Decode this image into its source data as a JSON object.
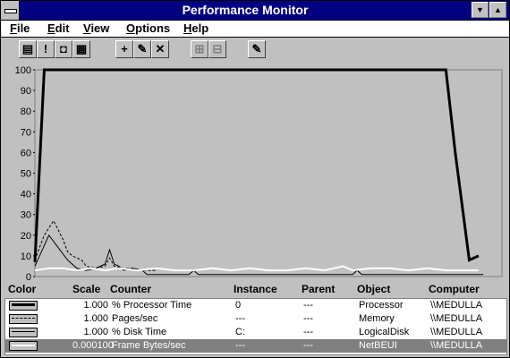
{
  "window": {
    "title": "Performance Monitor"
  },
  "titlebar": {
    "minimize_glyph": "▼",
    "maximize_glyph": "▲"
  },
  "menu": [
    {
      "label": "File",
      "mnemonic": "F"
    },
    {
      "label": "Edit",
      "mnemonic": "E"
    },
    {
      "label": "View",
      "mnemonic": "V"
    },
    {
      "label": "Options",
      "mnemonic": "O"
    },
    {
      "label": "Help",
      "mnemonic": "H"
    }
  ],
  "toolbar": [
    {
      "name": "chart-view-icon",
      "glyph": "▤",
      "enabled": true
    },
    {
      "name": "alert-view-icon",
      "glyph": "!",
      "enabled": true
    },
    {
      "name": "log-view-icon",
      "glyph": "◘",
      "enabled": true
    },
    {
      "name": "report-view-icon",
      "glyph": "▦",
      "enabled": true
    },
    {
      "name": "add-counter-icon",
      "glyph": "+",
      "enabled": true
    },
    {
      "name": "edit-counter-icon",
      "glyph": "✎",
      "enabled": true
    },
    {
      "name": "delete-counter-icon",
      "glyph": "✕",
      "enabled": true
    },
    {
      "name": "update-data-icon",
      "glyph": "⊞",
      "enabled": false
    },
    {
      "name": "bookmark-icon",
      "glyph": "⊟",
      "enabled": false
    },
    {
      "name": "options-icon",
      "glyph": "✎",
      "enabled": true
    }
  ],
  "chart_data": {
    "type": "line",
    "ylim": [
      0,
      100
    ],
    "yticks": [
      "100",
      "90",
      "80",
      "70",
      "60",
      "50",
      "40",
      "30",
      "20",
      "10",
      "0"
    ],
    "xlim": [
      0,
      100
    ],
    "series": [
      {
        "style": "solid",
        "color": "#000000",
        "points": [
          [
            0,
            7
          ],
          [
            2,
            100
          ],
          [
            10,
            100
          ],
          [
            20,
            100
          ],
          [
            30,
            100
          ],
          [
            40,
            100
          ],
          [
            50,
            100
          ],
          [
            60,
            100
          ],
          [
            70,
            100
          ],
          [
            80,
            100
          ],
          [
            88,
            100
          ],
          [
            90,
            60
          ],
          [
            93,
            8
          ],
          [
            95,
            10
          ]
        ]
      },
      {
        "style": "dashed",
        "color": "#000000",
        "points": [
          [
            0,
            8
          ],
          [
            2,
            20
          ],
          [
            4,
            27
          ],
          [
            6,
            18
          ],
          [
            7,
            12
          ],
          [
            8,
            10
          ],
          [
            9,
            9
          ],
          [
            10,
            8
          ],
          [
            11,
            5
          ],
          [
            13,
            4
          ],
          [
            15,
            5
          ],
          [
            16,
            9
          ],
          [
            17,
            5
          ],
          [
            19,
            4
          ],
          [
            21,
            4
          ],
          [
            22,
            3
          ],
          [
            24,
            3
          ],
          [
            26,
            3
          ]
        ]
      },
      {
        "style": "solid",
        "color": "#000000",
        "points": [
          [
            0,
            5
          ],
          [
            3,
            20
          ],
          [
            5,
            14
          ],
          [
            7,
            8
          ],
          [
            9,
            4
          ],
          [
            11,
            3
          ],
          [
            13,
            4
          ],
          [
            15,
            6
          ],
          [
            16,
            13
          ],
          [
            17,
            6
          ],
          [
            18,
            5
          ],
          [
            19,
            3
          ],
          [
            21,
            4
          ],
          [
            23,
            3
          ],
          [
            24,
            1
          ],
          [
            33,
            1
          ],
          [
            34,
            3
          ],
          [
            35,
            1
          ],
          [
            68,
            1
          ],
          [
            69,
            3
          ],
          [
            70,
            1
          ],
          [
            96,
            1
          ]
        ]
      },
      {
        "style": "solid",
        "color": "#ffffff",
        "points": [
          [
            0,
            3
          ],
          [
            3,
            4
          ],
          [
            6,
            4
          ],
          [
            9,
            3
          ],
          [
            12,
            4
          ],
          [
            15,
            3
          ],
          [
            18,
            4
          ],
          [
            22,
            3
          ],
          [
            26,
            4
          ],
          [
            30,
            3
          ],
          [
            34,
            3
          ],
          [
            38,
            4
          ],
          [
            42,
            3
          ],
          [
            46,
            4
          ],
          [
            50,
            3
          ],
          [
            54,
            3
          ],
          [
            58,
            4
          ],
          [
            62,
            3
          ],
          [
            66,
            5
          ],
          [
            68,
            3
          ],
          [
            72,
            4
          ],
          [
            76,
            4
          ],
          [
            80,
            3
          ],
          [
            84,
            4
          ],
          [
            88,
            3
          ],
          [
            92,
            3
          ],
          [
            95,
            3
          ]
        ]
      }
    ]
  },
  "legend": {
    "headers": {
      "color": "Color",
      "scale": "Scale",
      "counter": "Counter",
      "instance": "Instance",
      "parent": "Parent",
      "object": "Object",
      "computer": "Computer"
    },
    "rows": [
      {
        "swatch": "thick-solid",
        "scale": "1.000",
        "counter": "% Processor Time",
        "instance": "0",
        "parent": "---",
        "object": "Processor",
        "computer": "\\\\MEDULLA"
      },
      {
        "swatch": "dashed",
        "scale": "1.000",
        "counter": "Pages/sec",
        "instance": "---",
        "parent": "---",
        "object": "Memory",
        "computer": "\\\\MEDULLA"
      },
      {
        "swatch": "solid",
        "scale": "1.000",
        "counter": "% Disk Time",
        "instance": "C:",
        "parent": "---",
        "object": "LogicalDisk",
        "computer": "\\\\MEDULLA"
      },
      {
        "swatch": "white",
        "scale": "0.000100",
        "counter": "Frame Bytes/sec",
        "instance": "---",
        "parent": "---",
        "object": "NetBEUI",
        "computer": "\\\\MEDULLA",
        "selected": true
      }
    ]
  }
}
